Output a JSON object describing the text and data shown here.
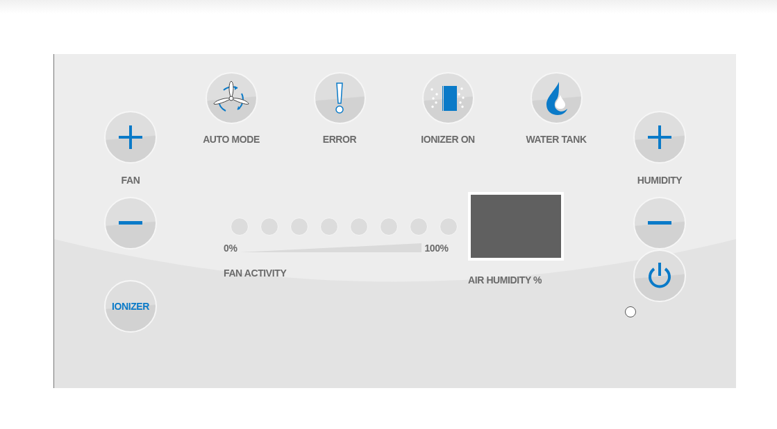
{
  "indicators": [
    {
      "kind": "auto",
      "label": "AUTO MODE",
      "on": false
    },
    {
      "kind": "error",
      "label": "ERROR",
      "on": false
    },
    {
      "kind": "ionizer",
      "label": "IONIZER ON",
      "on": false
    },
    {
      "kind": "water",
      "label": "WATER TANK",
      "on": false
    }
  ],
  "fan": {
    "label": "FAN"
  },
  "humidity": {
    "label": "HUMIDITY"
  },
  "ionizer_button": {
    "label": "IONIZER"
  },
  "fan_activity": {
    "label": "FAN ACTIVITY",
    "min_label": "0%",
    "max_label": "100%",
    "leds": [
      {
        "on": false
      },
      {
        "on": false
      },
      {
        "on": false
      },
      {
        "on": false
      },
      {
        "on": false
      },
      {
        "on": false
      },
      {
        "on": false
      },
      {
        "on": false
      }
    ]
  },
  "air_humidity": {
    "label": "AIR HUMIDITY %"
  },
  "power": {
    "led_on": false
  }
}
